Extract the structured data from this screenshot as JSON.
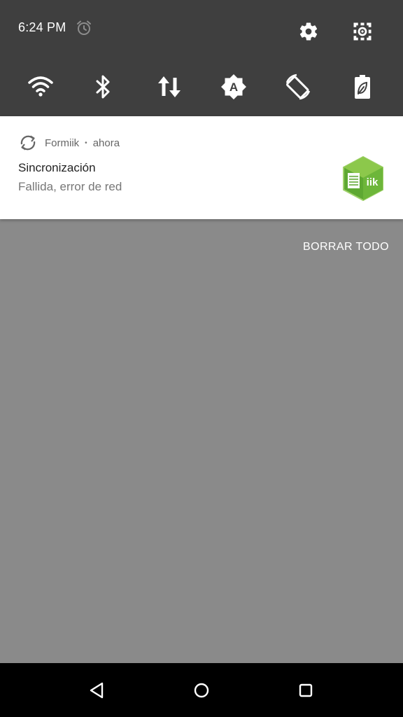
{
  "status_bar": {
    "time": "6:24 PM",
    "alarm_icon": "alarm-clock-icon"
  },
  "quick_settings": {
    "settings_icon": "gear-icon",
    "edit_icon": "edit-tiles-icon",
    "tiles": [
      {
        "name": "wifi",
        "icon": "wifi-icon"
      },
      {
        "name": "bluetooth",
        "icon": "bluetooth-icon"
      },
      {
        "name": "mobile-data",
        "icon": "data-arrows-icon"
      },
      {
        "name": "auto-brightness",
        "icon": "auto-brightness-icon"
      },
      {
        "name": "auto-rotate",
        "icon": "screen-rotation-icon"
      },
      {
        "name": "battery-saver",
        "icon": "battery-saver-icon"
      }
    ]
  },
  "notification": {
    "app_name": "Formiik",
    "separator": "•",
    "time": "ahora",
    "title": "Sincronización",
    "text": "Fallida, error de red",
    "app_icon_text": "iik",
    "accent_color": "#7ac143"
  },
  "clear_all_label": "BORRAR TODO",
  "colors": {
    "shade": "#3f3f3f",
    "scrim": "#8a8a8a",
    "navbar": "#000000"
  }
}
